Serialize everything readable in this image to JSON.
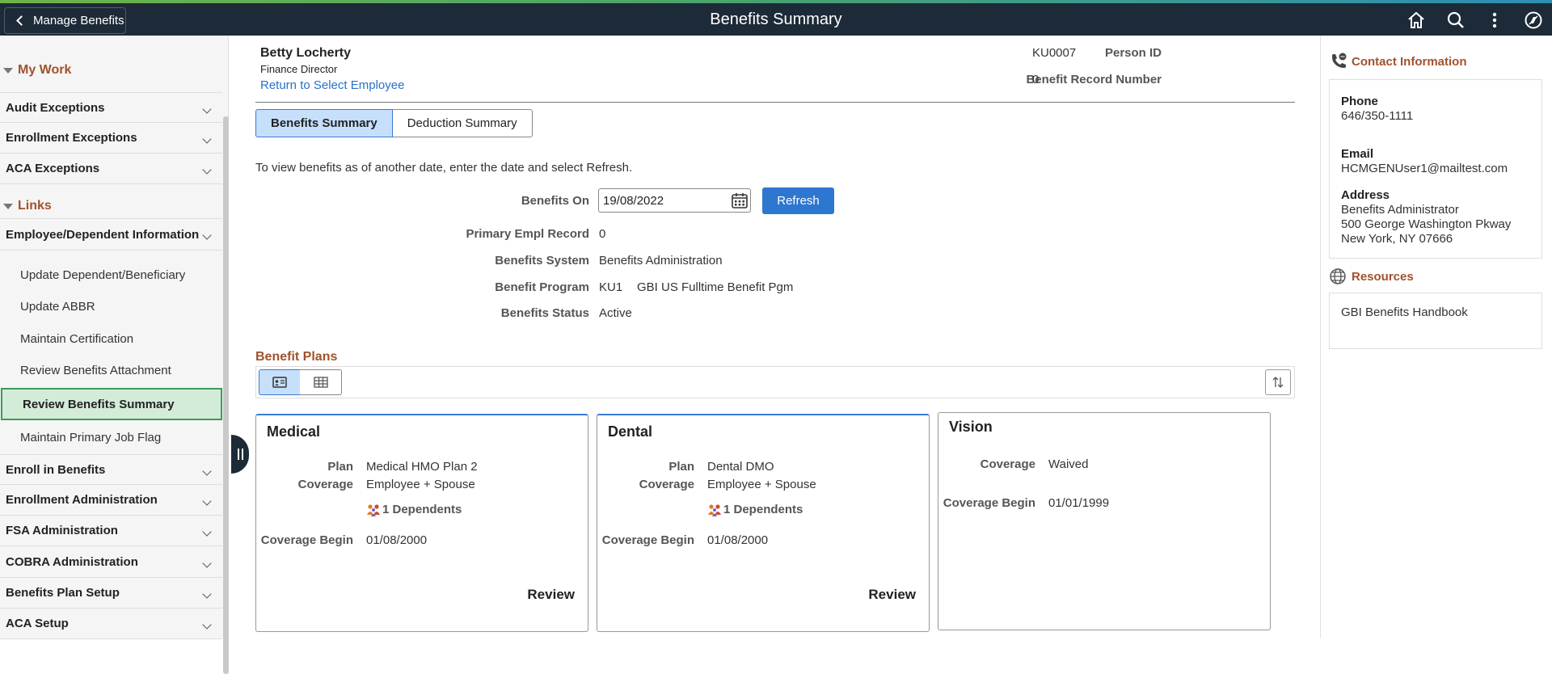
{
  "header": {
    "back_label": "Manage Benefits",
    "title": "Benefits Summary"
  },
  "leftnav": {
    "my_work_label": "My Work",
    "my_work_items": [
      "Audit Exceptions",
      "Enrollment Exceptions",
      "ACA Exceptions"
    ],
    "links_label": "Links",
    "employee_group": "Employee/Dependent Information",
    "employee_links": [
      "Update Dependent/Beneficiary",
      "Update ABBR",
      "Maintain Certification",
      "Review Benefits Attachment",
      "Review Benefits Summary",
      "Maintain Primary Job Flag"
    ],
    "other_groups": [
      "Enroll in Benefits",
      "Enrollment Administration",
      "FSA Administration",
      "COBRA Administration",
      "Benefits Plan Setup",
      "ACA Setup"
    ]
  },
  "employee": {
    "name": "Betty Locherty",
    "title": "Finance Director",
    "return_link": "Return to Select Employee",
    "person_id_label": "Person ID",
    "person_id": "KU0007",
    "record_label": "Benefit Record Number",
    "record": "0"
  },
  "tabs": [
    "Benefits Summary",
    "Deduction Summary"
  ],
  "form": {
    "instruction": "To view benefits as of another date, enter the date and select Refresh.",
    "benefits_on_label": "Benefits On",
    "benefits_on_value": "19/08/2022",
    "refresh_label": "Refresh",
    "primary_empl_label": "Primary Empl Record",
    "primary_empl_value": "0",
    "system_label": "Benefits System",
    "system_value": "Benefits Administration",
    "program_label": "Benefit Program",
    "program_code": "KU1",
    "program_value": "GBI US Fulltime Benefit Pgm",
    "status_label": "Benefits Status",
    "status_value": "Active"
  },
  "plans": {
    "section_title": "Benefit Plans",
    "cards": [
      {
        "title": "Medical",
        "plan_label": "Plan",
        "plan": "Medical HMO Plan 2",
        "coverage_label": "Coverage",
        "coverage": "Employee + Spouse",
        "dependents": "1 Dependents",
        "begin_label": "Coverage Begin",
        "begin": "01/08/2000",
        "review": "Review"
      },
      {
        "title": "Dental",
        "plan_label": "Plan",
        "plan": "Dental DMO",
        "coverage_label": "Coverage",
        "coverage": "Employee + Spouse",
        "dependents": "1 Dependents",
        "begin_label": "Coverage Begin",
        "begin": "01/08/2000",
        "review": "Review"
      },
      {
        "title": "Vision",
        "coverage_label": "Coverage",
        "coverage": "Waived",
        "begin_label": "Coverage Begin",
        "begin": "01/01/1999"
      }
    ]
  },
  "contact": {
    "heading": "Contact Information",
    "phone_label": "Phone",
    "phone": "646/350-1111",
    "email_label": "Email",
    "email": "HCMGENUser1@mailtest.com",
    "address_label": "Address",
    "address_lines": [
      "Benefits Administrator",
      "500 George Washington Pkway",
      "New York, NY 07666"
    ]
  },
  "resources": {
    "heading": "Resources",
    "link": "GBI Benefits Handbook"
  },
  "icons": {
    "home": "home-icon",
    "search": "search-icon",
    "more": "more-vertical-icon",
    "navbar": "compass-icon",
    "calendar": "calendar-icon",
    "dependents": "people-icon",
    "contact": "phone-icon",
    "resources": "globe-icon"
  },
  "colors": {
    "header_bg": "#1d2a38",
    "section_title": "#a0522d",
    "link": "#2970c8",
    "primary_button": "#2e77d0",
    "active_nav_bg": "#d3ecd8"
  }
}
